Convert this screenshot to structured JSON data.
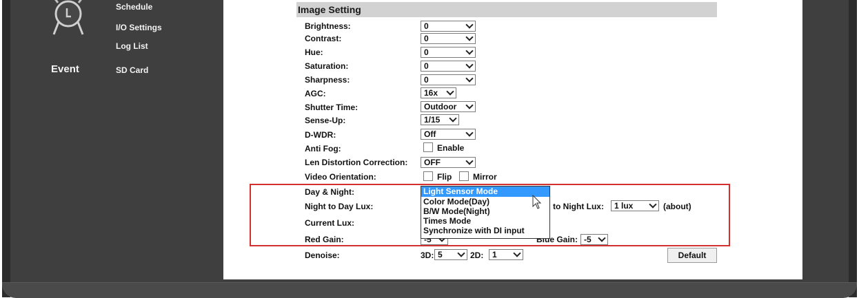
{
  "nav": {
    "links": [
      "Schedule",
      "I/O Settings",
      "Log List"
    ],
    "category": "Event",
    "category_link": "SD Card"
  },
  "section": {
    "title": "Image Setting"
  },
  "fields": {
    "brightness": {
      "label": "Brightness:",
      "value": "0"
    },
    "contrast": {
      "label": "Contrast:",
      "value": "0"
    },
    "hue": {
      "label": "Hue:",
      "value": "0"
    },
    "saturation": {
      "label": "Saturation:",
      "value": "0"
    },
    "sharpness": {
      "label": "Sharpness:",
      "value": "0"
    },
    "agc": {
      "label": "AGC:",
      "value": "16x"
    },
    "shutter": {
      "label": "Shutter Time:",
      "value": "Outdoor"
    },
    "senseup": {
      "label": "Sense-Up:",
      "value": "1/15"
    },
    "dwdr": {
      "label": "D-WDR:",
      "value": "Off"
    },
    "antifog": {
      "label": "Anti Fog:",
      "option": "Enable"
    },
    "lendist": {
      "label": "Len Distortion Correction:",
      "value": "OFF"
    },
    "orientation": {
      "label": "Video Orientation:",
      "flip": "Flip",
      "mirror": "Mirror"
    },
    "daynight": {
      "label": "Day & Night:"
    },
    "n2d": {
      "label": "Night to Day Lux:",
      "d2n_label": "to Night Lux:",
      "d2n_value": "1 lux",
      "suffix": "(about)"
    },
    "curlux": {
      "label": "Current Lux:"
    },
    "redgain": {
      "label": "Red Gain:",
      "value": "-5",
      "blue_label": "Blue Gain:",
      "blue_value": "-5"
    },
    "denoise": {
      "label": "Denoise:",
      "d3_label": "3D:",
      "d3_value": "5",
      "d2_label": "2D:",
      "d2_value": "1"
    }
  },
  "dropdown": {
    "options": [
      "Light Sensor Mode",
      "Color Mode(Day)",
      "B/W Mode(Night)",
      "Times Mode",
      "Synchronize with DI input"
    ],
    "selected_index": 0
  },
  "buttons": {
    "default": "Default"
  },
  "colors": {
    "highlight": "#3399ff",
    "annotation": "#d32f2f",
    "header": "#d2d2d2",
    "frame": "#3f3f3f"
  }
}
